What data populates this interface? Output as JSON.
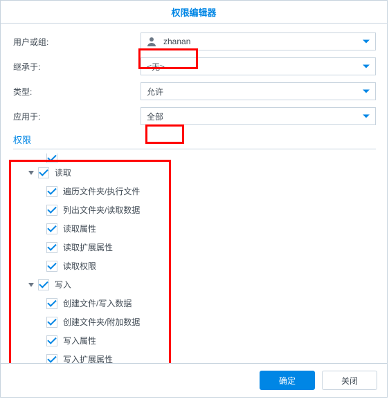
{
  "dialog": {
    "title": "权限编辑器"
  },
  "form": {
    "userOrGroup": {
      "label": "用户或组:",
      "value": "zhanan"
    },
    "inheritFrom": {
      "label": "继承于:",
      "value": "<无>"
    },
    "type": {
      "label": "类型:",
      "value": "允许"
    },
    "appliesTo": {
      "label": "应用于:",
      "value": "全部"
    }
  },
  "permissionsHeader": "权限",
  "tree": {
    "read": {
      "label": "读取",
      "children": [
        "遍历文件夹/执行文件",
        "列出文件夹/读取数据",
        "读取属性",
        "读取扩展属性",
        "读取权限"
      ]
    },
    "write": {
      "label": "写入",
      "children": [
        "创建文件/写入数据",
        "创建文件夹/附加数据",
        "写入属性",
        "写入扩展属性"
      ]
    }
  },
  "buttons": {
    "ok": "确定",
    "close": "关闭"
  }
}
